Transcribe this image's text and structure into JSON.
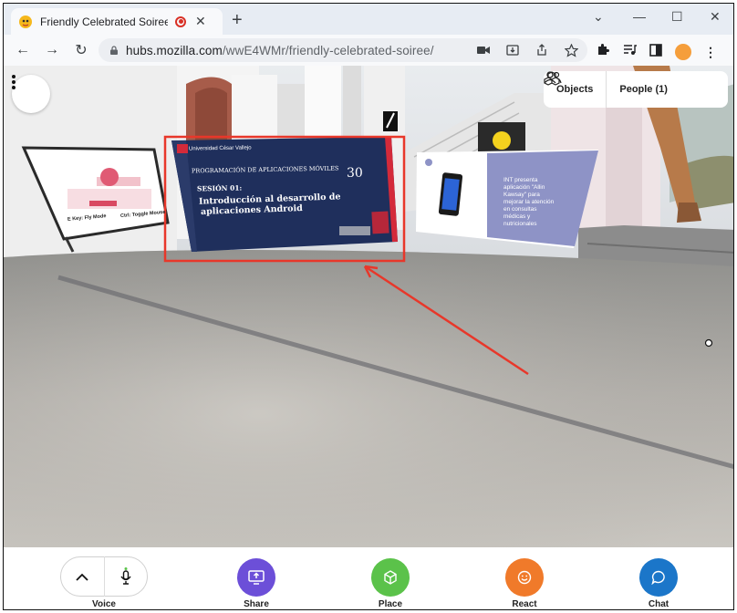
{
  "browser": {
    "tab_title": "Friendly Celebrated Soiree | ",
    "url_host": "hubs.mozilla.com",
    "url_path": "/wwE4WMr/friendly-celebrated-soiree/"
  },
  "hud": {
    "objects_label": "Objects",
    "people_label": "People (1)"
  },
  "slides": {
    "main": {
      "institution": "Universidad César Vallejo",
      "course": "PROGRAMACIÓN DE APLICACIONES MÓVILES",
      "session": "SESIÓN 01:",
      "topic_line1": "Introducción al desarrollo de",
      "topic_line2": "aplicaciones Android",
      "badge": "30"
    },
    "right": {
      "line1": "INT presenta",
      "line2": "aplicación \"Allin",
      "line3": "Kawsay\" para",
      "line4": "mejorar la atención",
      "line5": "en consultas",
      "line6": "médicas y",
      "line7": "nutricionales"
    },
    "left": {
      "key1": "E Key: Fly Mode",
      "key2": "Ctrl: Toggle Mouse"
    }
  },
  "bottombar": {
    "voice_label": "Voice",
    "share_label": "Share",
    "place_label": "Place",
    "react_label": "React",
    "chat_label": "Chat"
  },
  "colors": {
    "share": "#6c4fd8",
    "place": "#5bc24a",
    "react": "#f07a2a",
    "chat": "#1b76c9",
    "highlight": "#e8372a"
  }
}
